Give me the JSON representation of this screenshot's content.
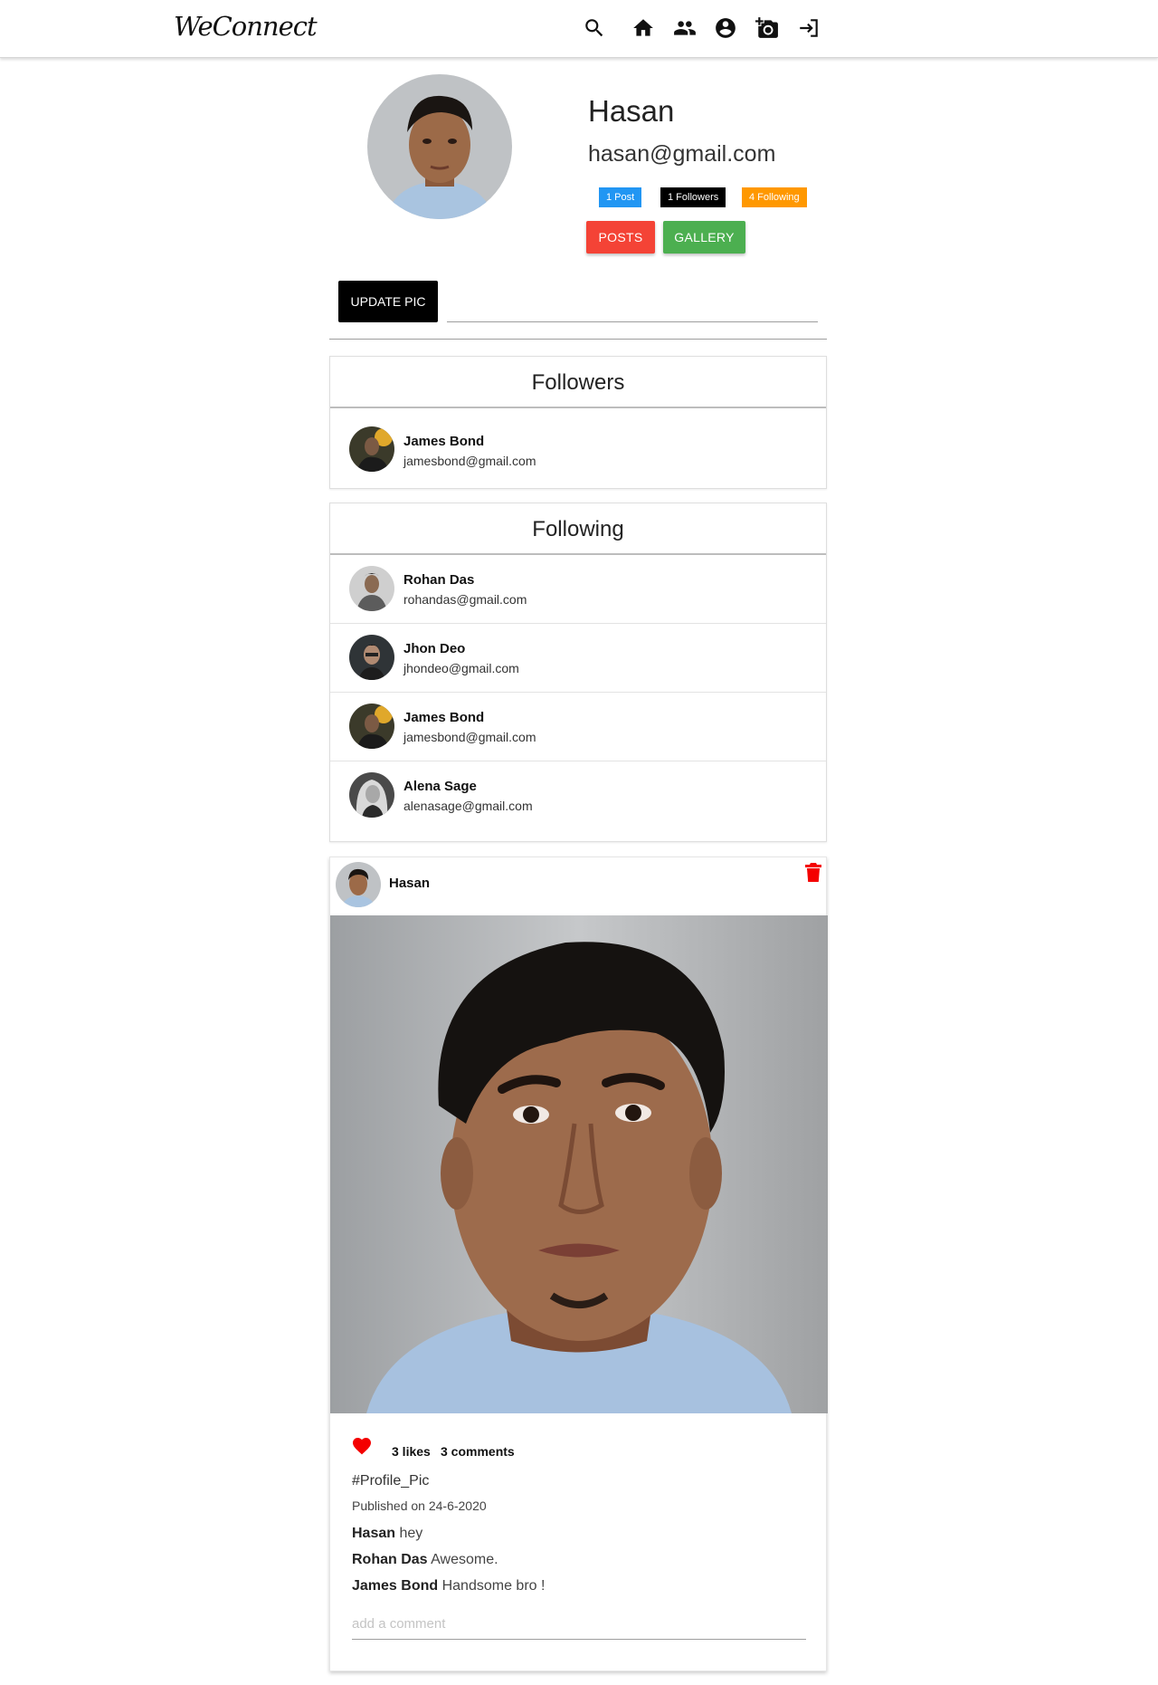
{
  "navbar": {
    "brand": "WeConnect",
    "icons": [
      "search-icon",
      "home-icon",
      "people-icon",
      "account-icon",
      "add-photo-icon",
      "logout-icon"
    ]
  },
  "profile": {
    "name": "Hasan",
    "email": "hasan@gmail.com",
    "posts_chip": "1 Post",
    "followers_chip": "1 Followers",
    "following_chip": "4 Following",
    "posts_button": "POSTS",
    "gallery_button": "GALLERY",
    "update_pic_button": "UPDATE PIC"
  },
  "followers": {
    "title": "Followers",
    "users": [
      {
        "name": "James Bond",
        "email": "jamesbond@gmail.com"
      }
    ]
  },
  "following": {
    "title": "Following",
    "users": [
      {
        "name": "Rohan Das",
        "email": "rohandas@gmail.com"
      },
      {
        "name": "Jhon Deo",
        "email": "jhondeo@gmail.com"
      },
      {
        "name": "James Bond",
        "email": "jamesbond@gmail.com"
      },
      {
        "name": "Alena Sage",
        "email": "alenasage@gmail.com"
      }
    ]
  },
  "post": {
    "author": "Hasan",
    "likes": "3 likes",
    "comments_count": "3 comments",
    "caption": "#Profile_Pic",
    "published": "Published on 24-6-2020",
    "comments": [
      {
        "author": "Hasan",
        "text": "hey"
      },
      {
        "author": "Rohan Das",
        "text": "Awesome."
      },
      {
        "author": "James Bond",
        "text": "Handsome bro !"
      }
    ],
    "comment_placeholder": "add a comment"
  },
  "colors": {
    "posts_button": "#f44336",
    "gallery_button": "#4caf50",
    "post_chip": "#2196f3",
    "followers_chip": "#000000",
    "following_chip": "#ff9800",
    "like_heart": "#f40000",
    "delete_icon": "#f40000"
  }
}
